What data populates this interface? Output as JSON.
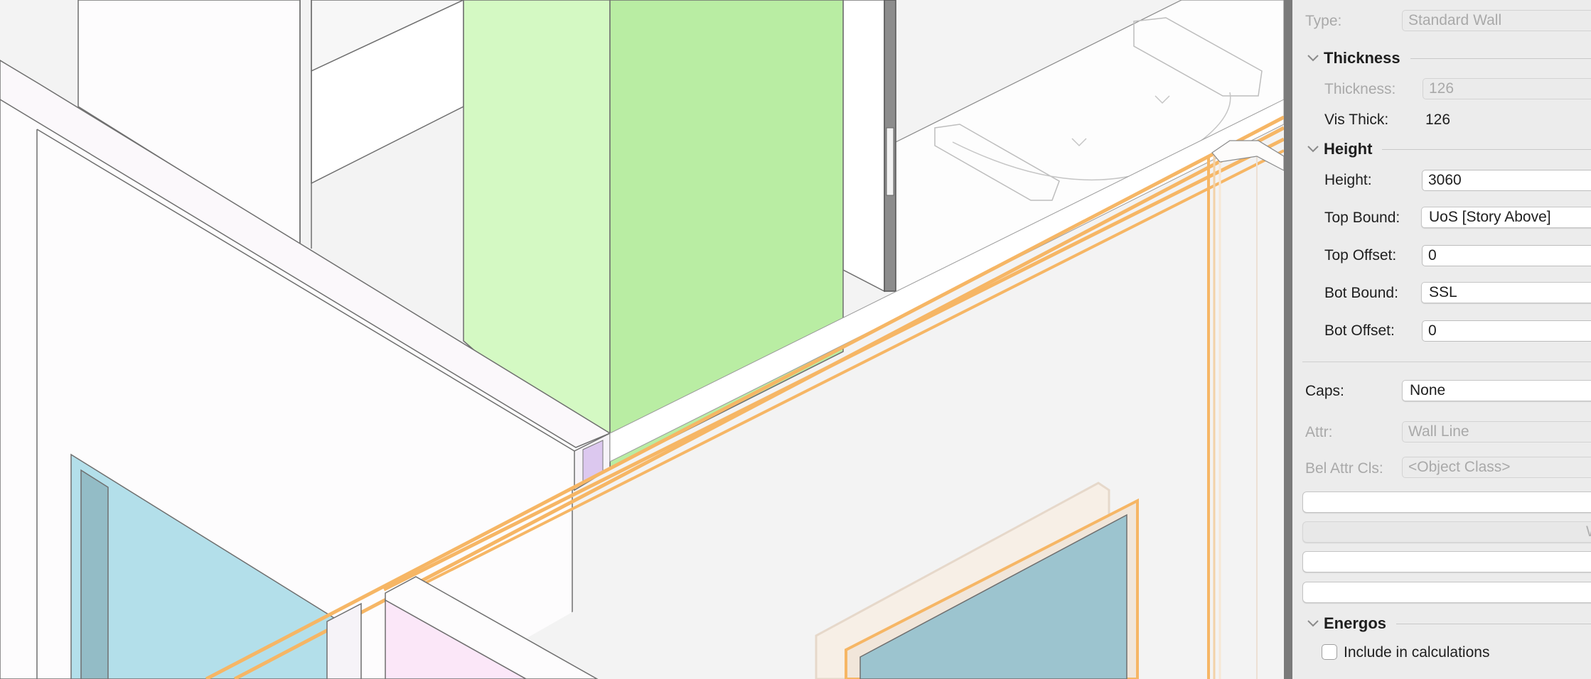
{
  "viewport": {
    "colors": {
      "background": "#f3f3f3",
      "green_light": "#d4f9c3",
      "green_dark": "#b9eda3",
      "blue": "#b3dfea",
      "blue_dark": "#93bcc6",
      "purple": "#dcc8ef",
      "pink": "#fbe7f8",
      "orange": "#f6b665",
      "outline": "#6f6f6f"
    }
  },
  "panel": {
    "type": {
      "label": "Type:",
      "value": "Standard Wall"
    },
    "thickness_section": {
      "title": "Thickness",
      "thickness": {
        "label": "Thickness:",
        "value": "126"
      },
      "vis_thick": {
        "label": "Vis Thick:",
        "value": "126"
      }
    },
    "height_section": {
      "title": "Height",
      "height": {
        "label": "Height:",
        "value": "3060"
      },
      "top_bound": {
        "label": "Top Bound:",
        "value": "UoS [Story Above]"
      },
      "top_offset": {
        "label": "Top Offset:",
        "value": "0"
      },
      "bot_bound": {
        "label": "Bot Bound:",
        "value": "SSL"
      },
      "bot_offset": {
        "label": "Bot Offset:",
        "value": "0"
      }
    },
    "caps": {
      "label": "Caps:",
      "value": "None"
    },
    "attr": {
      "label": "Attr:",
      "value": "Wall Line"
    },
    "bel_attr_cls": {
      "label": "Bel Attr Cls:",
      "value": "<Object Class>"
    },
    "buttons": [
      "",
      "W",
      "",
      ""
    ],
    "energos_section": {
      "title": "Energos",
      "include_label": "Include in calculations",
      "include_checked": false
    },
    "icons": {
      "section_toggle": "chevron-down-icon"
    }
  }
}
